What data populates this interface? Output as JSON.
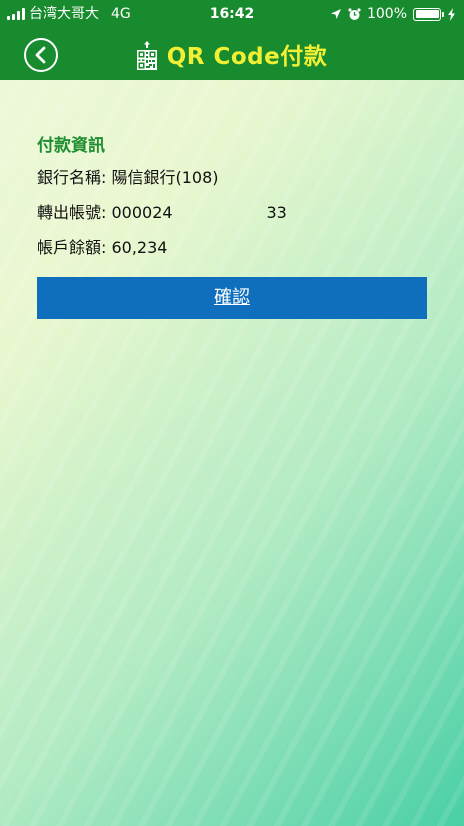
{
  "status_bar": {
    "carrier": "台湾大哥大",
    "network": "4G",
    "time": "16:42",
    "battery": "100%",
    "battery_level": 1.0
  },
  "nav": {
    "back_icon": "chevron-left-circle-icon",
    "title_icon": "qr-upload-icon",
    "title": "QR Code付款"
  },
  "payment_info": {
    "section_title": "付款資訊",
    "bank_label": "銀行名稱: ",
    "bank_value": "陽信銀行(108)",
    "account_label": "轉出帳號: ",
    "account_prefix": "000024",
    "account_suffix": "33",
    "balance_label": "帳戶餘額: ",
    "balance_value": "60,234"
  },
  "confirm_button": "確認",
  "colors": {
    "header_green": "#178b2d",
    "title_yellow": "#f2f035",
    "section_green": "#1e8f30",
    "button_blue": "#0f6fbd"
  }
}
